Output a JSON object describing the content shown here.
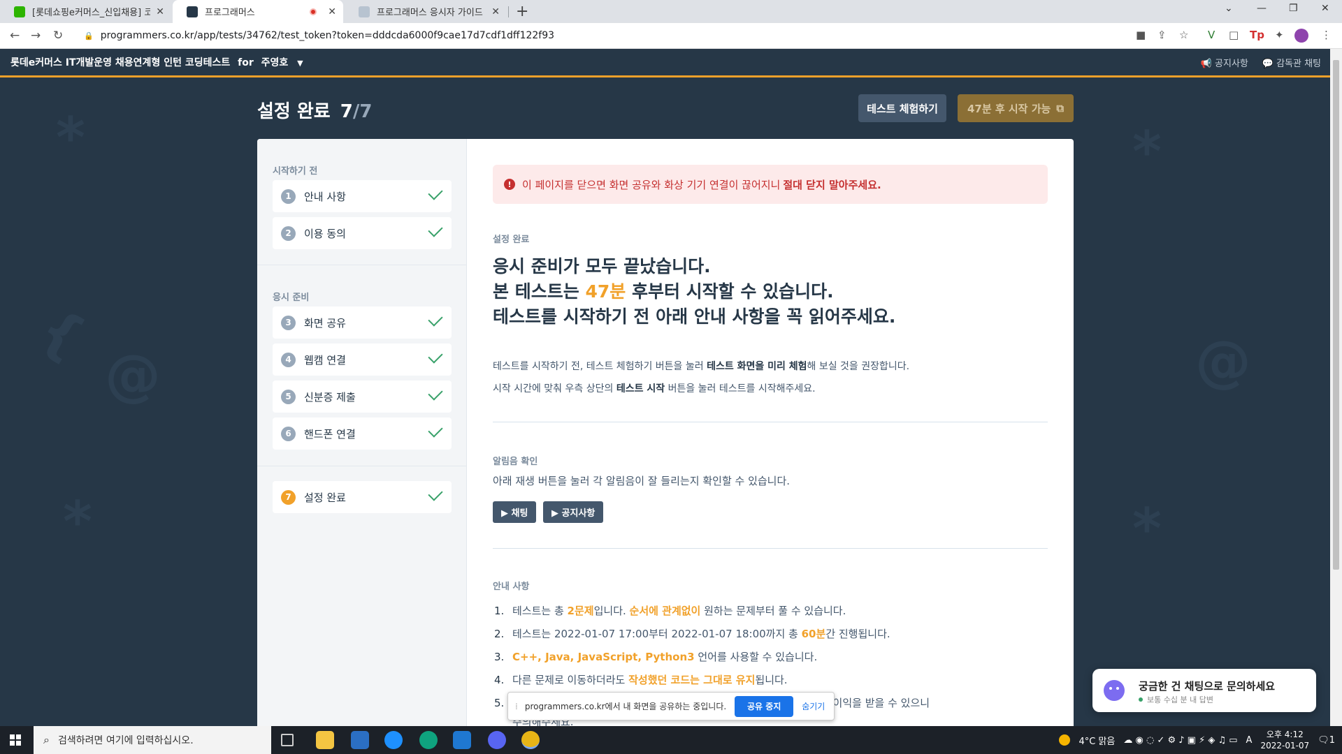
{
  "browser": {
    "tabs": [
      {
        "label": "[롯데쇼핑e커머스_신입채용] 코딩",
        "active": false
      },
      {
        "label": "프로그래머스",
        "active": true
      },
      {
        "label": "프로그래머스 응시자 가이드",
        "active": false
      }
    ],
    "url": "programmers.co.kr/app/tests/34762/test_token?token=dddcda6000f9cae17d7cdf1dff122f93"
  },
  "header": {
    "title": "롯데e커머스 IT개발운영 채용연계형 인턴 코딩테스트",
    "for_label": "for",
    "user": "주영호",
    "notice_link": "공지사항",
    "chat_link": "감독관 채팅"
  },
  "page": {
    "title": "설정 완료",
    "step_current": "7",
    "step_sep": "/",
    "step_total": "7",
    "try_button": "테스트 체험하기",
    "start_button": "47분 후 시작 가능"
  },
  "sidebar": {
    "section1": "시작하기 전",
    "section2": "응시 준비",
    "items": [
      {
        "num": "1",
        "label": "안내 사항"
      },
      {
        "num": "2",
        "label": "이용 동의"
      },
      {
        "num": "3",
        "label": "화면 공유"
      },
      {
        "num": "4",
        "label": "웹캠 연결"
      },
      {
        "num": "5",
        "label": "신분증 제출"
      },
      {
        "num": "6",
        "label": "핸드폰 연결"
      },
      {
        "num": "7",
        "label": "설정 완료"
      }
    ]
  },
  "content": {
    "alert_text": "이 페이지를 닫으면 화면 공유와 화상 기기 연결이 끊어지니",
    "alert_bold": "절대 닫지 말아주세요.",
    "done_label": "설정 완료",
    "headline1": "응시 준비가 모두 끝났습니다.",
    "headline2_pre": "본 테스트는",
    "headline2_hl": "47분",
    "headline2_post": "후부터 시작할 수 있습니다.",
    "headline3": "테스트를 시작하기 전 아래 안내 사항을 꼭 읽어주세요.",
    "para1_pre": "테스트를 시작하기 전, 테스트 체험하기 버튼을 눌러",
    "para1_bold": "테스트 화면을 미리 체험",
    "para1_post": "해 보실 것을 권장합니다.",
    "para2_pre": "시작 시간에 맞춰 우측 상단의",
    "para2_bold": "테스트 시작",
    "para2_post": "버튼을 눌러 테스트를 시작해주세요.",
    "sound_label": "알림음 확인",
    "sound_desc": "아래 재생 버튼을 눌러 각 알림음이 잘 들리는지 확인할 수 있습니다.",
    "sound_btn1": "▶ 채팅",
    "sound_btn2": "▶ 공지사항",
    "notice_label": "안내 사항",
    "notices": {
      "n1": {
        "num": "1.",
        "a": "테스트는 총 ",
        "b": "2문제",
        "c": "입니다. ",
        "d": "순서에 관계없이",
        "e": " 원하는 문제부터 풀 수 있습니다."
      },
      "n2": {
        "num": "2.",
        "a": "테스트는 2022-01-07 17:00부터 2022-01-07 18:00까지 총 ",
        "b": "60분",
        "c": "간 진행됩니다."
      },
      "n3": {
        "num": "3.",
        "b": "C++, Java, JavaScript, Python3",
        "c": " 언어를 사용할 수 있습니다."
      },
      "n4": {
        "num": "4.",
        "a": "다른 문제로 이동하더라도 ",
        "b": "작성했던 코드는 그대로 유지",
        "c": "됩니다."
      },
      "n5": {
        "num": "5.",
        "a": "을 닫으면 불이익을 받을 수 있으니"
      },
      "n5b": "주의해주세요."
    }
  },
  "share_bar": {
    "text": "programmers.co.kr에서 내 화면을 공유하는 중입니다.",
    "stop": "공유 중지",
    "hide": "숨기기"
  },
  "chat": {
    "title": "궁금한 건 채팅으로 문의하세요",
    "status": "보통 수십 분 내 답변"
  },
  "taskbar": {
    "search_placeholder": "검색하려면 여기에 입력하십시오.",
    "weather": "4°C 맑음",
    "time": "오후 4:12",
    "date": "2022-01-07",
    "ime": "A",
    "notif_count": "1"
  }
}
